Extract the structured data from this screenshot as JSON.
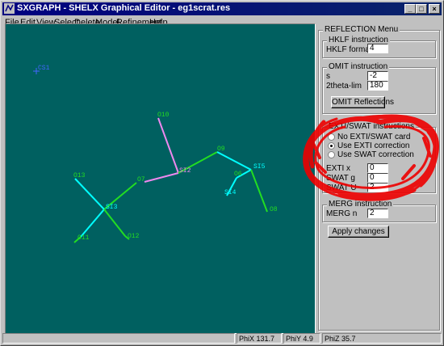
{
  "window": {
    "title": "SXGRAPH - SHELX Graphical Editor - eg1scrat.res",
    "minimize": "_",
    "maximize": "□",
    "close": "×"
  },
  "menu": {
    "items": [
      {
        "label": "File",
        "u": "F",
        "rest": "ile"
      },
      {
        "label": "Edit",
        "u": "E",
        "rest": "dit"
      },
      {
        "label": "View",
        "u": "V",
        "rest": "iew"
      },
      {
        "label": "Select",
        "u": "S",
        "rest": "elect"
      },
      {
        "label": "Delete",
        "u": "D",
        "rest": "elete"
      },
      {
        "label": "Model",
        "u": "M",
        "rest": "odel"
      },
      {
        "label": "Refinement",
        "u": "R",
        "rest": "efinement"
      },
      {
        "label": "Help",
        "u": "H",
        "rest": "elp"
      }
    ]
  },
  "molecule": {
    "atoms": [
      {
        "label": "CS1"
      },
      {
        "label": "O10"
      },
      {
        "label": "O9"
      },
      {
        "label": "SI5"
      },
      {
        "label": "O6"
      },
      {
        "label": "SI2"
      },
      {
        "label": "O13"
      },
      {
        "label": "O7"
      },
      {
        "label": "SI3"
      },
      {
        "label": "SI4"
      },
      {
        "label": "O8"
      },
      {
        "label": "O11"
      },
      {
        "label": "O12"
      }
    ]
  },
  "panel": {
    "title": "REFLECTION Menu",
    "hklf": {
      "title": "HKLF instruction",
      "format_label": "HKLF format",
      "format_value": "4"
    },
    "omit": {
      "title": "OMIT instruction",
      "s_label": "s",
      "s_value": "-2",
      "theta_label": "2theta-lim",
      "theta_value": "180",
      "button": "OMIT Reflections"
    },
    "exti": {
      "title": "EXTI/SWAT instructions",
      "options": [
        "No EXTI/SWAT card",
        "Use EXTI correction",
        "Use SWAT correction"
      ],
      "selected": "Use EXTI correction",
      "exti_label": "EXTI  x",
      "exti_value": "0",
      "swat_g_label": "SWAT  g",
      "swat_g_value": "0",
      "swat_u_label": "SWAT  U",
      "swat_u_value": "2"
    },
    "merg": {
      "title": "MERG instruction",
      "label": "MERG  n",
      "value": "2"
    },
    "apply_button": "Apply changes"
  },
  "status": {
    "phix_label": "PhiX",
    "phix_value": "131.7",
    "phiy_label": "PhiY",
    "phiy_value": "4.9",
    "phiz_label": "PhiZ",
    "phiz_value": "35.7"
  },
  "colors": {
    "canvas": "#006060",
    "oxygen_bond": "#22dd22",
    "silicon_bond": "#00ffff",
    "o10_bond": "#ee88ee",
    "cs_atom": "#4466ff",
    "annotation": "#ee0000"
  }
}
